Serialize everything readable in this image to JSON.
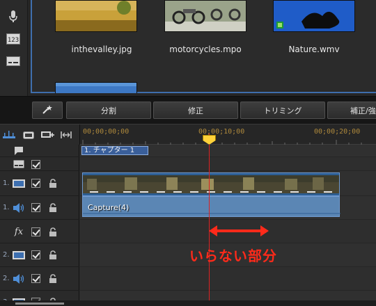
{
  "library": {
    "items": [
      {
        "name": "inthevalley.jpg"
      },
      {
        "name": "motorcycles.mpo"
      },
      {
        "name": "Nature.wmv"
      }
    ]
  },
  "toolbar": {
    "magic_icon": "magic-wand-icon",
    "buttons": [
      "分割",
      "修正",
      "トリミング",
      "補正/強"
    ]
  },
  "timeline": {
    "timecodes": [
      "00;00;00;00",
      "00;00;10;00",
      "00;00;20;00"
    ],
    "tracks": [
      {
        "number": "",
        "type": "chapter"
      },
      {
        "number": "",
        "type": "subtitle"
      },
      {
        "number": "1.",
        "type": "video"
      },
      {
        "number": "1.",
        "type": "audio"
      },
      {
        "number": "",
        "type": "effect",
        "label": "fx"
      },
      {
        "number": "2.",
        "type": "video"
      },
      {
        "number": "2.",
        "type": "audio"
      },
      {
        "number": "3.",
        "type": "video"
      }
    ],
    "chapter_label": "1. チャプター 1",
    "audio_clip_label": "Capture(4)",
    "playhead_time": "00;00;10;00"
  },
  "annotation": {
    "text": "いらない部分",
    "color": "#ff2a1a"
  },
  "colors": {
    "accent": "#3f6fae",
    "playhead": "#dd2222",
    "timecode": "#b08a3c"
  }
}
